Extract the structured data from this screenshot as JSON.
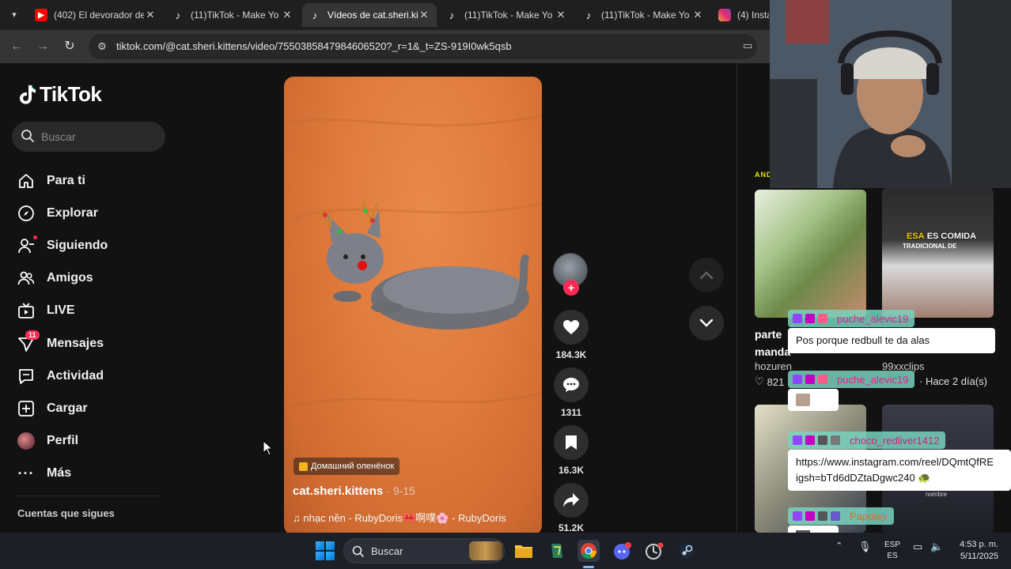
{
  "browser": {
    "tabs": [
      {
        "icon": "youtube-icon",
        "title": "(402) El devorador de",
        "active": false
      },
      {
        "icon": "tiktok-icon",
        "title": "(11)TikTok - Make Yo",
        "active": false
      },
      {
        "icon": "tiktok-icon",
        "title": "Vídeos de cat.sheri.ki",
        "active": true
      },
      {
        "icon": "tiktok-icon",
        "title": "(11)TikTok - Make Yo",
        "active": false
      },
      {
        "icon": "tiktok-icon",
        "title": "(11)TikTok - Make Yo",
        "active": false
      },
      {
        "icon": "instagram-icon",
        "title": "(4) Insta",
        "active": false
      }
    ],
    "url": "tiktok.com/@cat.sheri.kittens/video/7550385847984606520?_r=1&_t=ZS-919I0wk5qsb"
  },
  "sidebar": {
    "logo": "TikTok",
    "search_placeholder": "Buscar",
    "items": [
      {
        "label": "Para ti",
        "icon": "home-icon"
      },
      {
        "label": "Explorar",
        "icon": "compass-icon"
      },
      {
        "label": "Siguiendo",
        "icon": "following-icon"
      },
      {
        "label": "Amigos",
        "icon": "friends-icon"
      },
      {
        "label": "LIVE",
        "icon": "live-icon"
      },
      {
        "label": "Mensajes",
        "icon": "messages-icon",
        "badge": "11"
      },
      {
        "label": "Actividad",
        "icon": "activity-icon"
      },
      {
        "label": "Cargar",
        "icon": "upload-icon"
      },
      {
        "label": "Perfil",
        "icon": "avatar"
      },
      {
        "label": "Más",
        "icon": "more-icon"
      }
    ],
    "following_header": "Cuentas que sigues"
  },
  "video": {
    "chip": "Домашний оленёнок",
    "author": "cat.sheri.kittens",
    "date": "· 9-15",
    "music": "nhạc nền - RubyDoris🎀啊噗🌸 - RubyDoris"
  },
  "actions": {
    "likes": "184.3K",
    "comments": "1311",
    "saves": "16.3K",
    "shares": "51.2K"
  },
  "right_panel": {
    "tag": "ANDA",
    "thumb_b_line1_highlight": "ESA",
    "thumb_b_line1_rest": "ES COMIDA",
    "thumb_b_line2": "TRADICIONAL DE",
    "title_line1": "parte",
    "title_line2": "manda",
    "user1": "hozuren",
    "user2": "99xxclips",
    "likes": "821",
    "time": "· Hace 2 día(s)",
    "thumb_d_caption": "nombre"
  },
  "chat": [
    {
      "user": "puche_alevic19",
      "message": "Pos porque redbull te da alas"
    },
    {
      "user": "puche_alevic19",
      "message": ""
    },
    {
      "user": "choco_redliver1412",
      "message_line1": "https://www.instagram.com/reel/DQmtQfRE",
      "message_line2": "igsh=bTd6dDZtaDgwc240"
    },
    {
      "user": "Papotejr",
      "message": ""
    }
  ],
  "taskbar": {
    "search_placeholder": "Buscar",
    "lang_line1": "ESP",
    "lang_line2": "ES",
    "time": "4:53 p. m.",
    "date": "5/11/2025"
  }
}
